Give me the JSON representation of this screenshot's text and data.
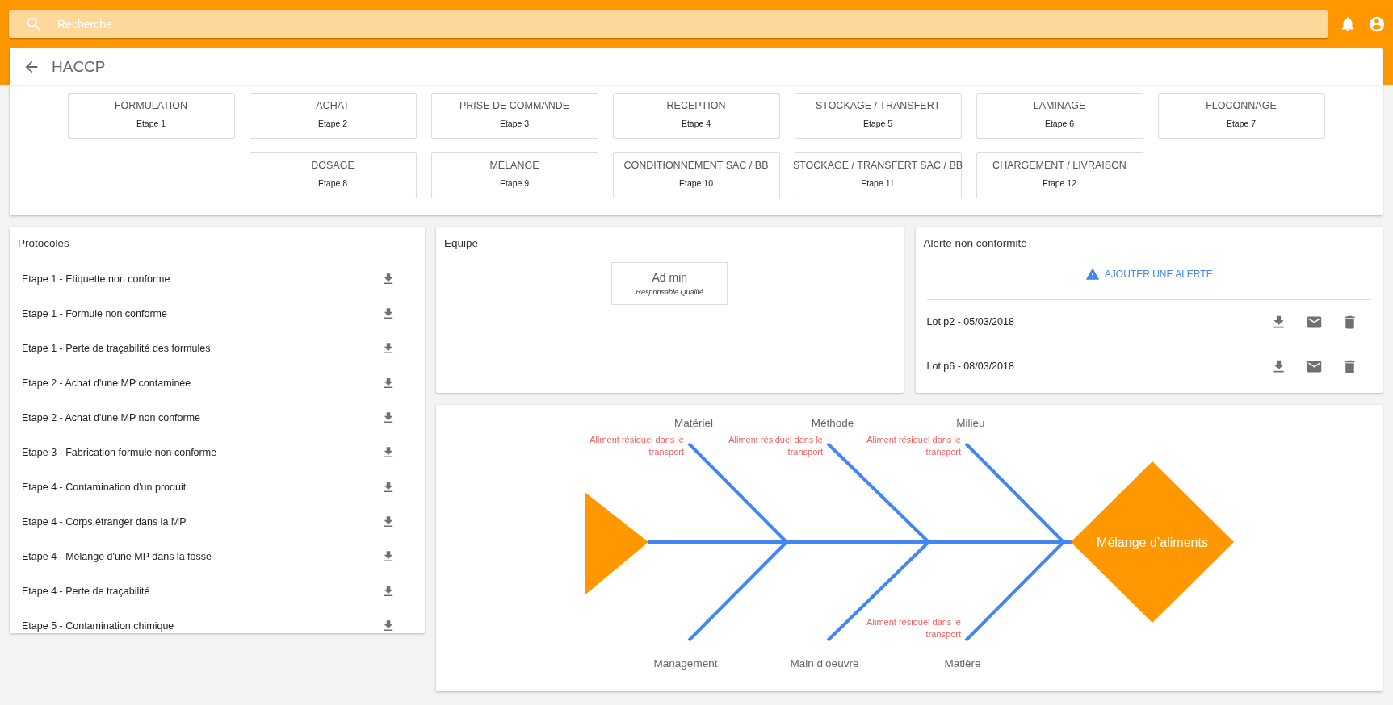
{
  "search": {
    "placeholder": "Recherche"
  },
  "page": {
    "title": "HACCP"
  },
  "steps": [
    {
      "name": "FORMULATION",
      "label": "Etape 1"
    },
    {
      "name": "ACHAT",
      "label": "Etape 2"
    },
    {
      "name": "PRISE DE COMMANDE",
      "label": "Etape 3"
    },
    {
      "name": "RECEPTION",
      "label": "Etape 4"
    },
    {
      "name": "STOCKAGE / TRANSFERT",
      "label": "Etape 5"
    },
    {
      "name": "LAMINAGE",
      "label": "Etape 6"
    },
    {
      "name": "FLOCONNAGE",
      "label": "Etape 7"
    },
    {
      "name": "DOSAGE",
      "label": "Etape 8"
    },
    {
      "name": "MELANGE",
      "label": "Etape 9"
    },
    {
      "name": "CONDITIONNEMENT SAC / BB",
      "label": "Etape 10"
    },
    {
      "name": "STOCKAGE / TRANSFERT SAC / BB",
      "label": "Etape 11"
    },
    {
      "name": "CHARGEMENT / LIVRAISON",
      "label": "Etape 12"
    }
  ],
  "protocols": {
    "title": "Protocoles",
    "items": [
      "Etape 1 - Etiquette non conforme",
      "Etape 1 - Formule non conforme",
      "Etape 1 - Perte de traçabilité des formules",
      "Etape 2 - Achat d'une MP contaminée",
      "Etape 2 - Achat d'une MP non conforme",
      "Etape 3 - Fabrication formule non conforme",
      "Etape 4 - Contamination d'un produit",
      "Etape 4 - Corps étranger dans la MP",
      "Etape 4 - Mélange d'une MP dans la fosse",
      "Etape 4 - Perte de traçabilité",
      "Etape 5 - Contamination chimique"
    ]
  },
  "team": {
    "title": "Equipe",
    "members": [
      {
        "name": "Ad min",
        "role": "Responsable Qualité"
      }
    ]
  },
  "alerts": {
    "title": "Alerte non conformité",
    "add_button": "AJOUTER UNE ALERTE",
    "items": [
      "Lot p2 - 05/03/2018",
      "Lot p6 - 08/03/2018"
    ]
  },
  "fishbone": {
    "effect": "Mélange d’aliments",
    "top_branches": [
      {
        "label": "Matériel",
        "causes": [
          "Aliment résiduel dans le transport"
        ]
      },
      {
        "label": "Méthode",
        "causes": [
          "Aliment résiduel dans le transport"
        ]
      },
      {
        "label": "Milieu",
        "causes": [
          "Aliment résiduel dans le transport"
        ]
      }
    ],
    "bottom_branches": [
      {
        "label": "Management"
      },
      {
        "label": "Main d’oeuvre"
      },
      {
        "label": "Matière",
        "causes": [
          "Aliment résiduel dans le transport"
        ]
      }
    ]
  }
}
